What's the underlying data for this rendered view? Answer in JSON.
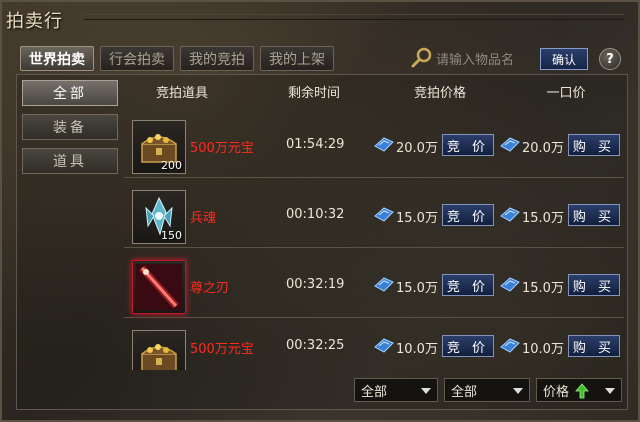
{
  "window": {
    "title": "拍卖行"
  },
  "tabs": [
    {
      "label": "世界拍卖",
      "active": true
    },
    {
      "label": "行会拍卖",
      "active": false
    },
    {
      "label": "我的竞拍",
      "active": false
    },
    {
      "label": "我的上架",
      "active": false
    }
  ],
  "search": {
    "placeholder": "请输入物品名",
    "icon": "magnifier-icon",
    "confirm_label": "确认",
    "help_label": "?"
  },
  "sidebar": {
    "items": [
      {
        "label": "全部",
        "active": true
      },
      {
        "label": "装备",
        "active": false
      },
      {
        "label": "道具",
        "active": false
      }
    ]
  },
  "table": {
    "headers": {
      "item": "竞拍道具",
      "time": "剩余时间",
      "bid_price": "竞拍价格",
      "buyout": "一口价"
    },
    "rows": [
      {
        "name": "500万元宝",
        "count": "200",
        "icon": "treasure-chest-icon",
        "time": "01:54:29",
        "bid_price": "20.0万",
        "bid_label": "竞 价",
        "buyout_price": "20.0万",
        "buy_label": "购 买"
      },
      {
        "name": "兵魂",
        "count": "150",
        "icon": "soul-crystal-icon",
        "time": "00:10:32",
        "bid_price": "15.0万",
        "bid_label": "竞 价",
        "buyout_price": "15.0万",
        "buy_label": "购 买"
      },
      {
        "name": "尊之刃",
        "count": "",
        "icon": "blade-icon",
        "time": "00:32:19",
        "bid_price": "15.0万",
        "bid_label": "竞 价",
        "buyout_price": "15.0万",
        "buy_label": "购 买"
      },
      {
        "name": "500万元宝",
        "count": "",
        "icon": "treasure-chest-icon",
        "time": "00:32:25",
        "bid_price": "10.0万",
        "bid_label": "竞 价",
        "buyout_price": "10.0万",
        "buy_label": "购 买"
      }
    ]
  },
  "filters": {
    "filter1": "全部",
    "filter2": "全部",
    "sort": "价格"
  },
  "colors": {
    "item_name": "#ff2a1e",
    "button_blue": "#152546",
    "sort_arrow": "#3fbf2a"
  }
}
